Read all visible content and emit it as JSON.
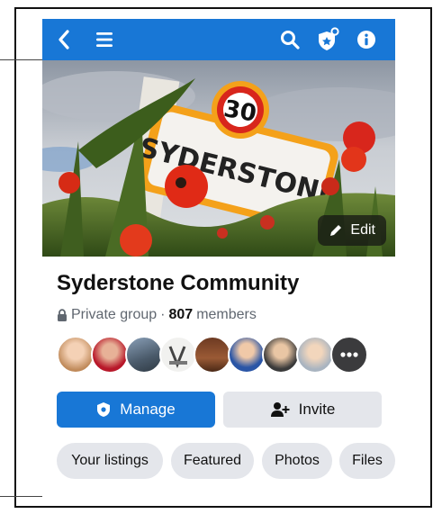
{
  "group": {
    "name": "Syderstone Community",
    "privacy": "Private group",
    "separator": "·",
    "member_count": "807",
    "member_label": "members"
  },
  "cover": {
    "sign_text": "SYDERSTONE",
    "speed_limit": "30",
    "edit_label": "Edit"
  },
  "actions": {
    "manage_label": "Manage",
    "invite_label": "Invite"
  },
  "tabs": [
    "Your listings",
    "Featured",
    "Photos",
    "Files"
  ],
  "colors": {
    "brand_blue": "#1877d6",
    "chip_gray": "#e4e6eb"
  },
  "icons": {
    "back": "chevron-left-icon",
    "menu": "hamburger-menu-icon",
    "search": "search-icon",
    "admin": "shield-badge-icon",
    "info": "info-icon",
    "edit": "pencil-icon",
    "lock": "lock-icon",
    "manage": "shield-icon",
    "invite": "add-person-icon"
  }
}
